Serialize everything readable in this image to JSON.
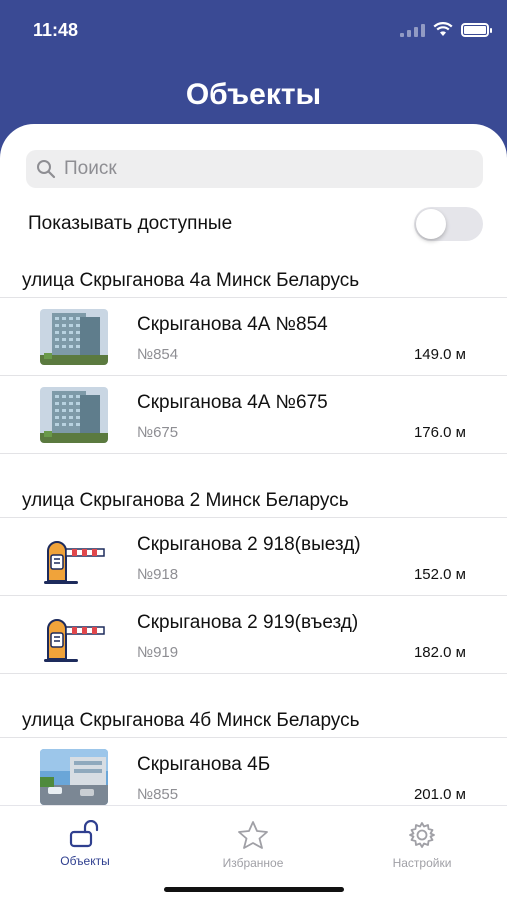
{
  "status_bar": {
    "time": "11:48"
  },
  "header": {
    "title": "Объекты"
  },
  "search": {
    "placeholder": "Поиск"
  },
  "filter": {
    "show_available_label": "Показывать доступные",
    "show_available_on": false
  },
  "sections": [
    {
      "title": "улица Скрыганова 4а Минск Беларусь",
      "items": [
        {
          "name": "Скрыганова 4А №854",
          "number": "№854",
          "distance": "149.0 м",
          "thumb": "building"
        },
        {
          "name": "Скрыганова 4А №675",
          "number": "№675",
          "distance": "176.0 м",
          "thumb": "building"
        }
      ]
    },
    {
      "title": "улица Скрыганова 2 Минск Беларусь",
      "items": [
        {
          "name": "Скрыганова 2 918(выезд)",
          "number": "№918",
          "distance": "152.0 м",
          "thumb": "barrier"
        },
        {
          "name": "Скрыганова 2 919(въезд)",
          "number": "№919",
          "distance": "182.0 м",
          "thumb": "barrier"
        }
      ]
    },
    {
      "title": "улица Скрыганова 4б Минск Беларусь",
      "items": [
        {
          "name": "Скрыганова 4Б",
          "number": "№855",
          "distance": "201.0 м",
          "thumb": "parking"
        }
      ]
    }
  ],
  "tabbar": {
    "objects": "Объекты",
    "favorites": "Избранное",
    "settings": "Настройки"
  },
  "colors": {
    "header_bg": "#3a4a94",
    "active_tab": "#2f3f8f"
  }
}
